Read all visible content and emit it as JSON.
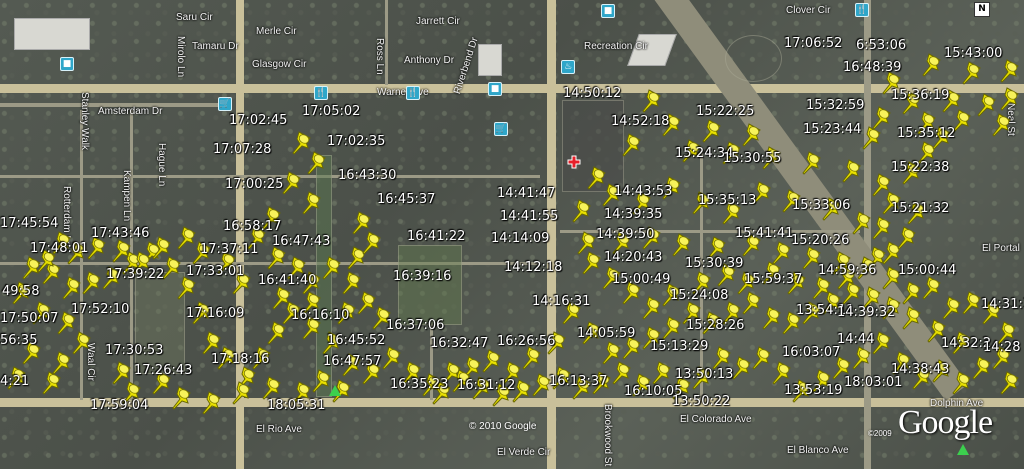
{
  "map": {
    "compass": "N",
    "copyright": "© 2010 Google",
    "brand_line": "©2009",
    "brand": "Google",
    "colors": {
      "pin": "#e8e000",
      "road_main": "#c9c09a",
      "poi": "#2fa6c9",
      "marker": "#e8202a",
      "camera": "#3ccf4e"
    }
  },
  "streets": [
    "Saru Cir",
    "Tamaru Dr",
    "Mirolo Ln",
    "Merle Cir",
    "Glasgow Cir",
    "Jarrett Cir",
    "Ross Ln",
    "Anthony Dr",
    "Riverbend Dr",
    "Clover Cir",
    "Warner Ave",
    "Amsterdam Dr",
    "Stanley Walk",
    "Rotterdam Ln",
    "Kampen Ln",
    "Hague Ln",
    "Waal Cir",
    "El Rio Ave",
    "El Colorado Ave",
    "El Verde Cir",
    "Brookwood St",
    "El Blanco Ave",
    "Dolphin Ave",
    "El Portal",
    "Neal St",
    "Recreation Cir"
  ],
  "times": [
    "17:06:52",
    "6:53:06",
    "15:43:00",
    "16:48:39",
    "14:50:12",
    "15:22:25",
    "15:32:59",
    "15:36:19",
    "17:02:45",
    "17:05:02",
    "14:52:18",
    "15:23:44",
    "15:35:12",
    "17:07:28",
    "17:02:35",
    "15:24:34",
    "15:30:55",
    "15:22:38",
    "17:00:25",
    "16:43:30",
    "14:41:47",
    "14:43:53",
    "16:45:37",
    "15:35:13",
    "15:33:06",
    "15:21:32",
    "14:41:55",
    "14:39:35",
    "17:45:54",
    "16:58:17",
    "17:43:46",
    "16:47:43",
    "16:41:22",
    "14:14:09",
    "14:39:50",
    "15:41:41",
    "15:20:26",
    "17:48:01",
    "17:37:11",
    "14:20:43",
    "15:30:39",
    "14:59:36",
    "15:00:44",
    "17:39:22",
    "17:33:01",
    "16:39:16",
    "14:12:18",
    "49:58",
    "16:41:40",
    "15:00:49",
    "15:59:37",
    "15:24:08",
    "14:31:1",
    "17:52:10",
    "14:16:31",
    "17:50:07",
    "17:16:09",
    "16:16:10",
    "13:54:11",
    "14:39:32",
    "16:37:06",
    "15:28:26",
    "56:35",
    "16:45:52",
    "14:05:59",
    "14:32:2",
    "14:28",
    "16:32:47",
    "16:26:56",
    "15:13:29",
    "14:44",
    "16:03:07",
    "17:30:53",
    "17:18:16",
    "16:47:57",
    "17:26:43",
    "14:38:43",
    "4:21",
    "16:35:23",
    "16:31:12",
    "16:13:37",
    "13:50:13",
    "13:53:19",
    "18:03:01",
    "16:10:05",
    "17:59:04",
    "18:05:31",
    "13:50:22"
  ]
}
